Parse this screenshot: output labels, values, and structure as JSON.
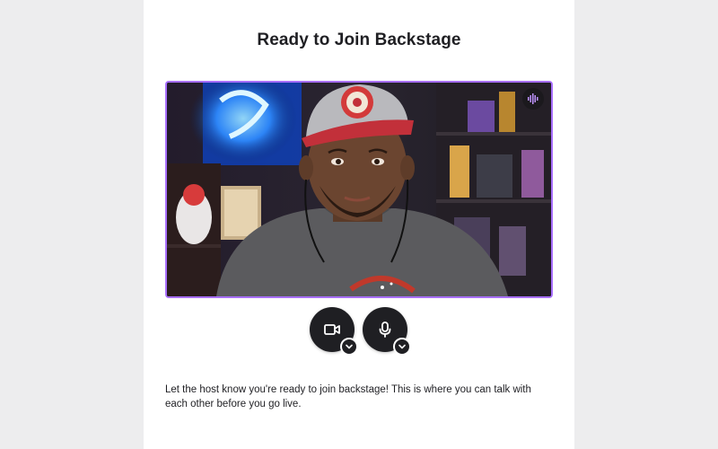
{
  "dialog": {
    "title": "Ready to Join Backstage",
    "description": "Let the host know you're ready to join backstage! This is where you can talk with each other before you go live."
  },
  "video_preview": {
    "audio_indicator_icon": "audio-waveform-icon",
    "accent_color": "#a970ff"
  },
  "controls": {
    "camera_icon": "video-camera-icon",
    "microphone_icon": "microphone-icon",
    "dropdown_icon": "chevron-down-icon"
  },
  "colors": {
    "background": "#ededee",
    "panel": "#ffffff",
    "text": "#1f1f23",
    "button": "#1f1f23"
  }
}
